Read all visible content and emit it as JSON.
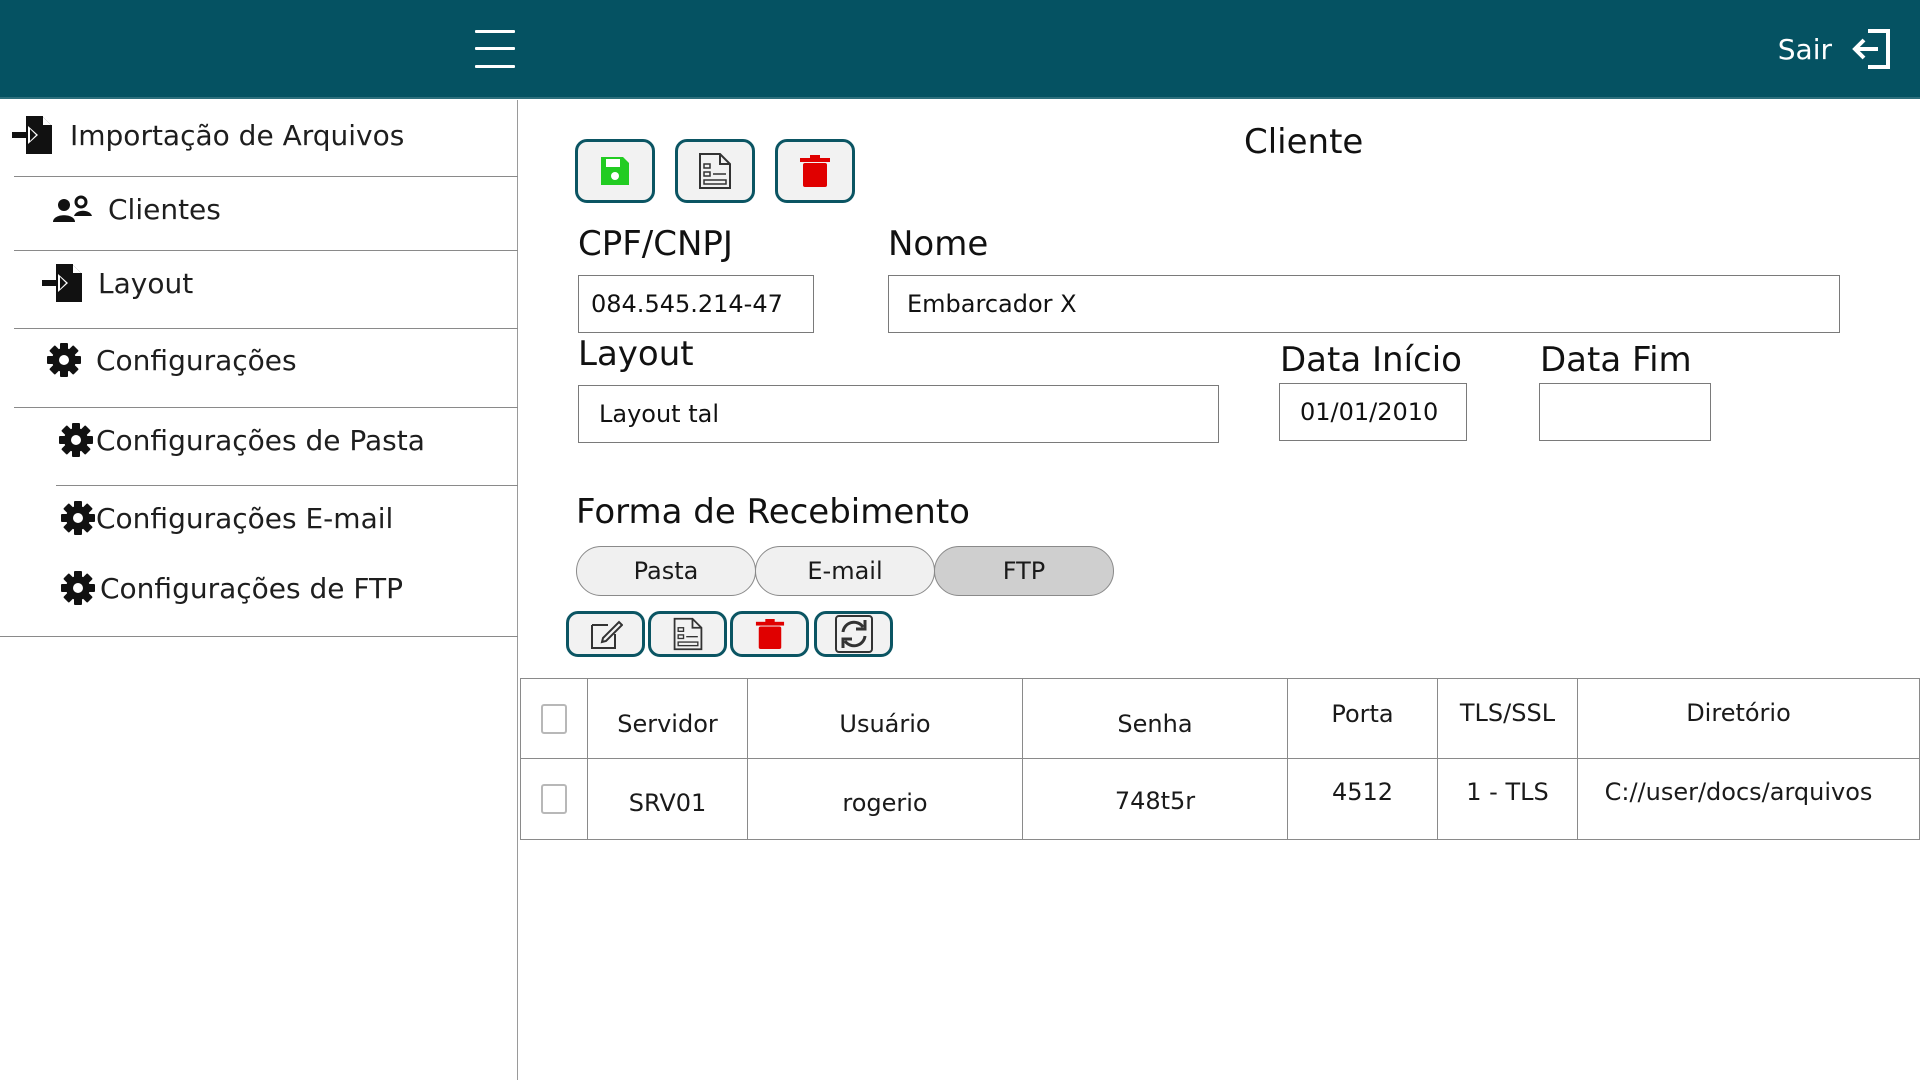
{
  "header": {
    "menu_icon": "hamburger-icon",
    "logout_label": "Sair",
    "logout_icon": "logout-icon"
  },
  "sidebar": {
    "items": [
      {
        "label": "Importação de Arquivos",
        "icon": "file-import-icon"
      },
      {
        "label": "Clientes",
        "icon": "users-icon"
      },
      {
        "label": "Layout",
        "icon": "file-import-icon"
      },
      {
        "label": "Configurações",
        "icon": "gear-icon"
      },
      {
        "label": "Configurações de Pasta",
        "icon": "gear-icon"
      },
      {
        "label": "Configurações E-mail",
        "icon": "gear-icon"
      },
      {
        "label": "Configurações de FTP",
        "icon": "gear-icon"
      }
    ]
  },
  "form": {
    "title": "Cliente",
    "toolbar_icons": [
      "save-icon",
      "form-icon",
      "trash-icon"
    ],
    "cpf_label": "CPF/CNPJ",
    "cpf_value": "084.545.214-47",
    "nome_label": "Nome",
    "nome_value": "Embarcador X",
    "layout_label": "Layout",
    "layout_value": "Layout tal",
    "data_inicio_label": "Data Início",
    "data_inicio_value": "01/01/2010",
    "data_fim_label": "Data Fim",
    "data_fim_value": ""
  },
  "recebimento": {
    "title": "Forma de Recebimento",
    "tabs": [
      "Pasta",
      "E-mail",
      "FTP"
    ],
    "active_tab": "FTP",
    "actions": [
      "edit-icon",
      "form-icon",
      "trash-icon",
      "refresh-icon"
    ]
  },
  "table": {
    "columns": [
      "Servidor",
      "Usuário",
      "Senha",
      "Porta",
      "TLS/SSL",
      "Diretório"
    ],
    "rows": [
      {
        "servidor": "SRV01",
        "usuario": "rogerio",
        "senha": "748t5r",
        "porta": "4512",
        "tls": "1 - TLS",
        "diretorio": "C://user/docs/arquivos"
      }
    ]
  },
  "colors": {
    "header_bg": "#055262",
    "button_border": "#0b5563",
    "save_icon": "#22cc22",
    "delete_icon": "#e00000",
    "active_tab_bg": "#cfcfcf"
  }
}
